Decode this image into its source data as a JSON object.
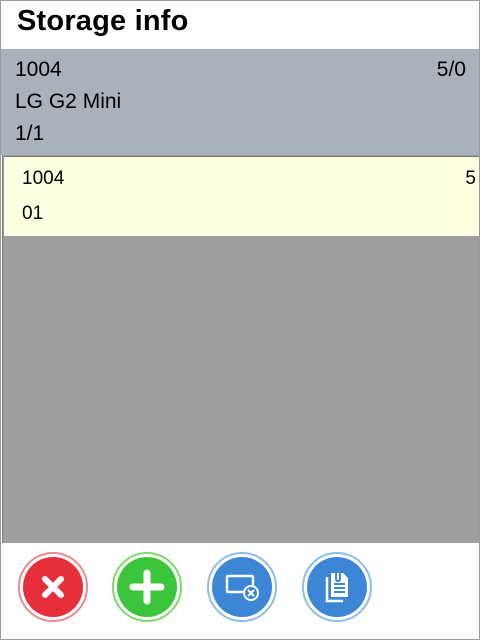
{
  "header": {
    "title": "Storage info"
  },
  "info": {
    "code": "1004",
    "count": "5/0",
    "product": "LG G2 Mini",
    "page": "1/1"
  },
  "list": {
    "items": [
      {
        "code": "1004",
        "quantity": "5",
        "location": "01"
      }
    ]
  },
  "toolbar": {
    "buttons": [
      {
        "icon": "close-circle-icon",
        "color": "#e62f3b"
      },
      {
        "icon": "plus-circle-icon",
        "color": "#3bc53a"
      },
      {
        "icon": "remove-item-icon",
        "color": "#3d86d6"
      },
      {
        "icon": "clipboard-document-icon",
        "color": "#3d86d6"
      }
    ]
  }
}
